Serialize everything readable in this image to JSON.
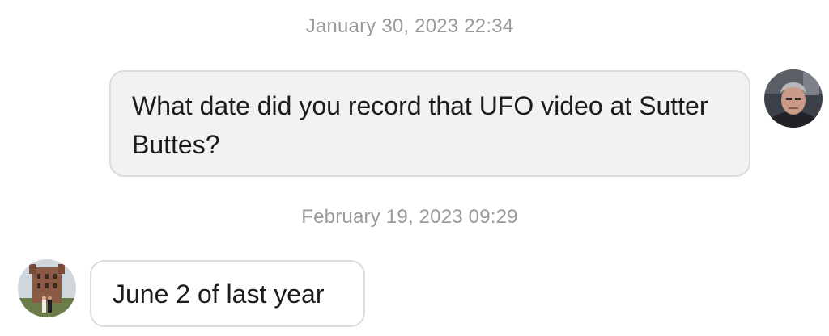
{
  "messages": [
    {
      "timestamp": "January 30, 2023 22:34",
      "direction": "outgoing",
      "text": "What date did you record that UFO video at Sutter Buttes?",
      "avatar_icon": "man-portrait-avatar-icon"
    },
    {
      "timestamp": "February 19, 2023 09:29",
      "direction": "incoming",
      "text": "June 2 of last year",
      "avatar_icon": "castle-photo-avatar-icon"
    }
  ],
  "colors": {
    "outgoing_bubble_bg": "#f2f2f4",
    "incoming_bubble_bg": "#ffffff",
    "bubble_border": "#dcdce0",
    "timestamp_text": "#9a9a9f",
    "message_text": "#1c1c1e"
  }
}
